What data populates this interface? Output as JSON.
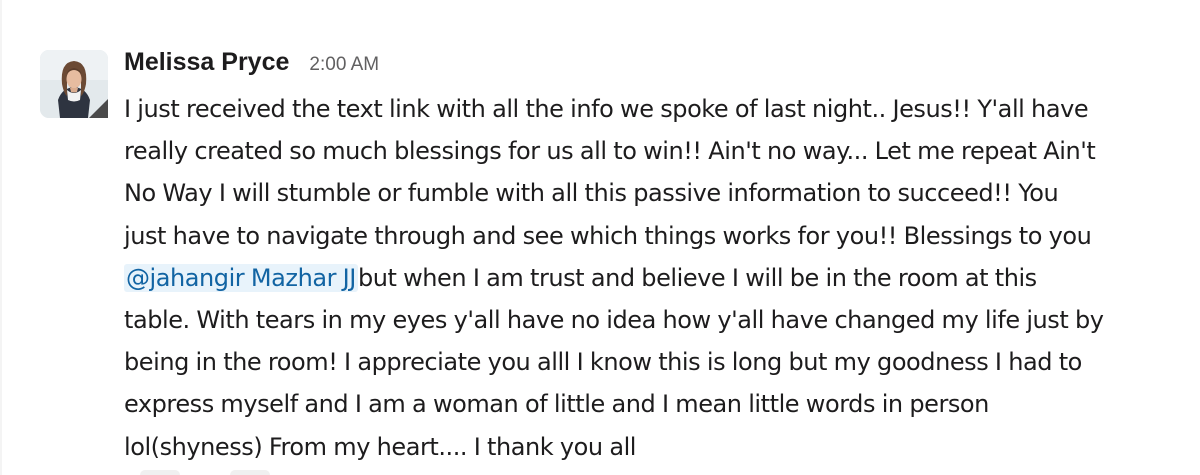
{
  "message": {
    "sender": {
      "name": "Melissa Pryce",
      "avatar_icon": "profile-photo-avatar"
    },
    "timestamp": "2:00 AM",
    "lines": [
      {
        "text": "I just received the text link with all the info we spoke of last night.. Jesus!! Y'all have"
      },
      {
        "text": "really created so much blessings for us all to win!! Ain't no way... Let me repeat Ain't"
      },
      {
        "text": "No Way I will stumble or fumble with all this passive information to succeed!! You"
      },
      {
        "text": "just have to navigate through and see which things works for you!! Blessings to you"
      },
      {
        "mention": "@jahangir Mazhar JJ",
        "text": "but when I am trust and believe I will be in the room at this"
      },
      {
        "text": "table. With tears in my eyes y'all have no idea how y'all have changed my life just by"
      },
      {
        "text": "being in the room! I appreciate you alll I know this is long but my goodness I had to"
      },
      {
        "text": "express myself and I am a woman of little and I mean little words in person"
      },
      {
        "text": "lol(shyness) From my heart.... I thank you all"
      }
    ],
    "colors": {
      "mention_text": "#1264a3",
      "mention_background": "#e8f3fb",
      "body_text": "#1d1c1d",
      "timestamp_text": "#616061"
    }
  }
}
